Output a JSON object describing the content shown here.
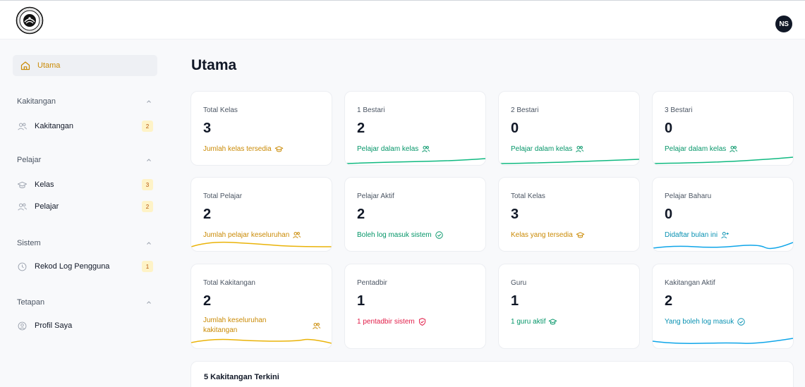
{
  "header": {
    "avatar_initials": "NS"
  },
  "sidebar": {
    "active": {
      "label": "Utama",
      "icon": "home-icon"
    },
    "sections": [
      {
        "title": "Kakitangan",
        "items": [
          {
            "label": "Kakitangan",
            "badge": "2",
            "icon": "users-icon"
          }
        ]
      },
      {
        "title": "Pelajar",
        "items": [
          {
            "label": "Kelas",
            "badge": "3",
            "icon": "graduation-cap-icon"
          },
          {
            "label": "Pelajar",
            "badge": "2",
            "icon": "users-icon"
          }
        ]
      },
      {
        "title": "Sistem",
        "items": [
          {
            "label": "Rekod Log Pengguna",
            "badge": "1",
            "icon": "clock-icon"
          }
        ]
      },
      {
        "title": "Tetapan",
        "items": [
          {
            "label": "Profil Saya",
            "badge": "",
            "icon": "user-circle-icon"
          }
        ]
      }
    ]
  },
  "main": {
    "title": "Utama",
    "cards": [
      {
        "title": "Total Kelas",
        "value": "3",
        "subtitle": "Jumlah kelas tersedia",
        "color": "#ca8a04",
        "icon": "graduation-cap-icon"
      },
      {
        "title": "1 Bestari",
        "value": "2",
        "subtitle": "Pelajar dalam kelas",
        "color": "#059669",
        "icon": "users-icon"
      },
      {
        "title": "2 Bestari",
        "value": "0",
        "subtitle": "Pelajar dalam kelas",
        "color": "#059669",
        "icon": "users-icon"
      },
      {
        "title": "3 Bestari",
        "value": "0",
        "subtitle": "Pelajar dalam kelas",
        "color": "#059669",
        "icon": "users-icon"
      },
      {
        "title": "Total Pelajar",
        "value": "2",
        "subtitle": "Jumlah pelajar keseluruhan",
        "color": "#ca8a04",
        "icon": "users-icon"
      },
      {
        "title": "Pelajar Aktif",
        "value": "2",
        "subtitle": "Boleh log masuk sistem",
        "color": "#059669",
        "icon": "check-circle-icon"
      },
      {
        "title": "Total Kelas",
        "value": "3",
        "subtitle": "Kelas yang tersedia",
        "color": "#ca8a04",
        "icon": "graduation-cap-icon"
      },
      {
        "title": "Pelajar Baharu",
        "value": "0",
        "subtitle": "Didaftar bulan ini",
        "color": "#0891b2",
        "icon": "user-plus-icon"
      },
      {
        "title": "Total Kakitangan",
        "value": "2",
        "subtitle": "Jumlah keseluruhan kakitangan",
        "color": "#ca8a04",
        "icon": "users-icon"
      },
      {
        "title": "Pentadbir",
        "value": "1",
        "subtitle": "1 pentadbir sistem",
        "color": "#e11d48",
        "icon": "shield-check-icon"
      },
      {
        "title": "Guru",
        "value": "1",
        "subtitle": "1 guru aktif",
        "color": "#059669",
        "icon": "graduation-cap-icon"
      },
      {
        "title": "Kakitangan Aktif",
        "value": "2",
        "subtitle": "Yang boleh log masuk",
        "color": "#0891b2",
        "icon": "check-circle-icon"
      }
    ],
    "recent_staff_title": "5 Kakitangan Terkini"
  }
}
